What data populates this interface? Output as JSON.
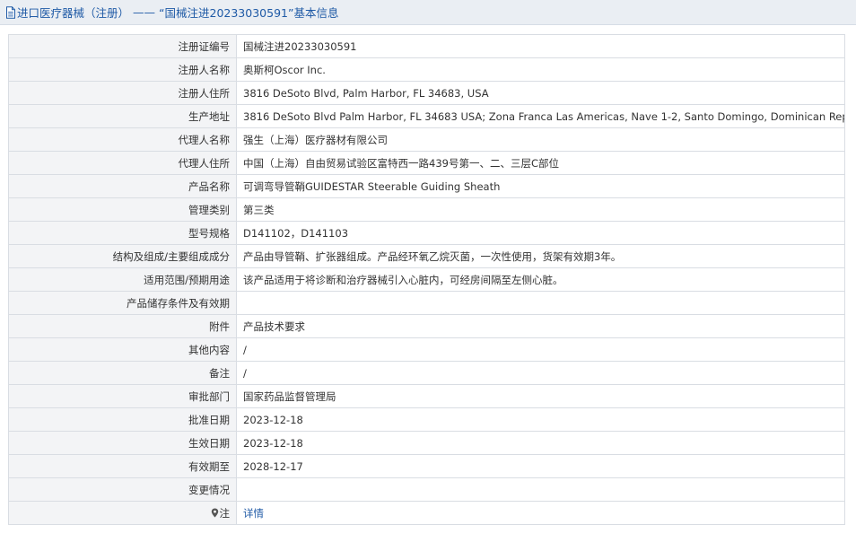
{
  "header": {
    "category": "进口医疗器械（注册）",
    "separator": "——",
    "title": "“国械注进20233030591”基本信息",
    "icon": "document-icon",
    "color": "#1f5aa6"
  },
  "fields": [
    {
      "key": "注册证编号",
      "value": "国械注进20233030591"
    },
    {
      "key": "注册人名称",
      "value": "奥斯柯Oscor Inc."
    },
    {
      "key": "注册人住所",
      "value": "3816 DeSoto Blvd, Palm Harbor, FL 34683, USA"
    },
    {
      "key": "生产地址",
      "value": "3816 DeSoto Blvd Palm Harbor, FL 34683 USA; Zona Franca Las Americas, Nave 1-2, Santo Domingo, Dominican Republic"
    },
    {
      "key": "代理人名称",
      "value": "强生（上海）医疗器材有限公司"
    },
    {
      "key": "代理人住所",
      "value": "中国（上海）自由贸易试验区富特西一路439号第一、二、三层C部位"
    },
    {
      "key": "产品名称",
      "value": "可调弯导管鞘GUIDESTAR Steerable Guiding Sheath"
    },
    {
      "key": "管理类别",
      "value": "第三类"
    },
    {
      "key": "型号规格",
      "value": "D141102，D141103"
    },
    {
      "key": "结构及组成/主要组成成分",
      "value": "产品由导管鞘、扩张器组成。产品经环氧乙烷灭菌，一次性使用，货架有效期3年。"
    },
    {
      "key": "适用范围/预期用途",
      "value": "该产品适用于将诊断和治疗器械引入心脏内，可经房间隔至左侧心脏。"
    },
    {
      "key": "产品储存条件及有效期",
      "value": ""
    },
    {
      "key": "附件",
      "value": "产品技术要求"
    },
    {
      "key": "其他内容",
      "value": "/"
    },
    {
      "key": "备注",
      "value": "/"
    },
    {
      "key": "审批部门",
      "value": "国家药品监督管理局"
    },
    {
      "key": "批准日期",
      "value": "2023-12-18"
    },
    {
      "key": "生效日期",
      "value": "2023-12-18"
    },
    {
      "key": "有效期至",
      "value": "2028-12-17"
    },
    {
      "key": "变更情况",
      "value": ""
    }
  ],
  "footer_row": {
    "key": "注",
    "key_icon": "map-pin-icon",
    "link_label": "详情"
  }
}
